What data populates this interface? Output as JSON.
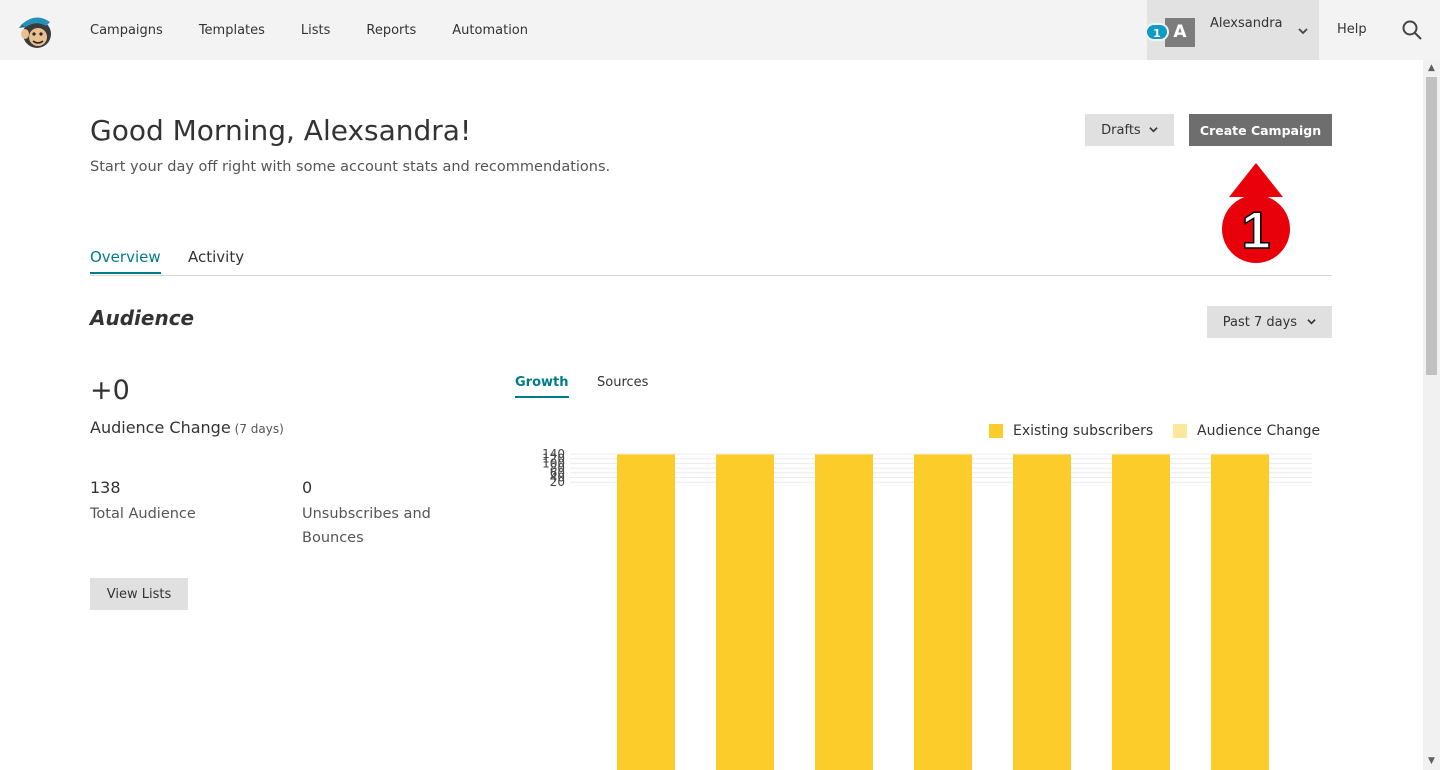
{
  "nav": {
    "links": [
      "Campaigns",
      "Templates",
      "Lists",
      "Reports",
      "Automation"
    ],
    "notification_count": "1",
    "avatar_initial": "A",
    "user_name": "Alexsandra",
    "help": "Help"
  },
  "header": {
    "greeting": "Good Morning, Alexsandra!",
    "subtitle": "Start your day off right with some account stats and recommendations.",
    "drafts_label": "Drafts",
    "create_label": "Create Campaign"
  },
  "annotation": {
    "number": "1"
  },
  "tabs": {
    "overview": "Overview",
    "activity": "Activity"
  },
  "audience": {
    "title": "Audience",
    "range_label": "Past 7 days",
    "change_value": "+0",
    "change_label": "Audience Change",
    "change_period": "(7 days)",
    "total_value": "138",
    "total_label": "Total Audience",
    "unsub_value": "0",
    "unsub_label": "Unsubscribes and Bounces",
    "view_lists_label": "View Lists"
  },
  "chart_tabs": {
    "growth": "Growth",
    "sources": "Sources"
  },
  "colors": {
    "accent": "#007c89",
    "bar_existing": "#fccd2a",
    "bar_change": "#fde79c"
  },
  "chart_data": {
    "type": "bar",
    "categories": [
      "",
      "",
      "",
      "",
      "",
      "",
      ""
    ],
    "series": [
      {
        "name": "Existing subscribers",
        "values": [
          138,
          138,
          138,
          138,
          138,
          138,
          138
        ]
      },
      {
        "name": "Audience Change",
        "values": [
          0,
          0,
          0,
          0,
          0,
          0,
          0
        ]
      }
    ],
    "yticks": [
      20,
      40,
      60,
      80,
      100,
      120,
      140
    ],
    "ylim": [
      0,
      140
    ],
    "stacked": true,
    "grid": true,
    "legend": "top-right"
  }
}
